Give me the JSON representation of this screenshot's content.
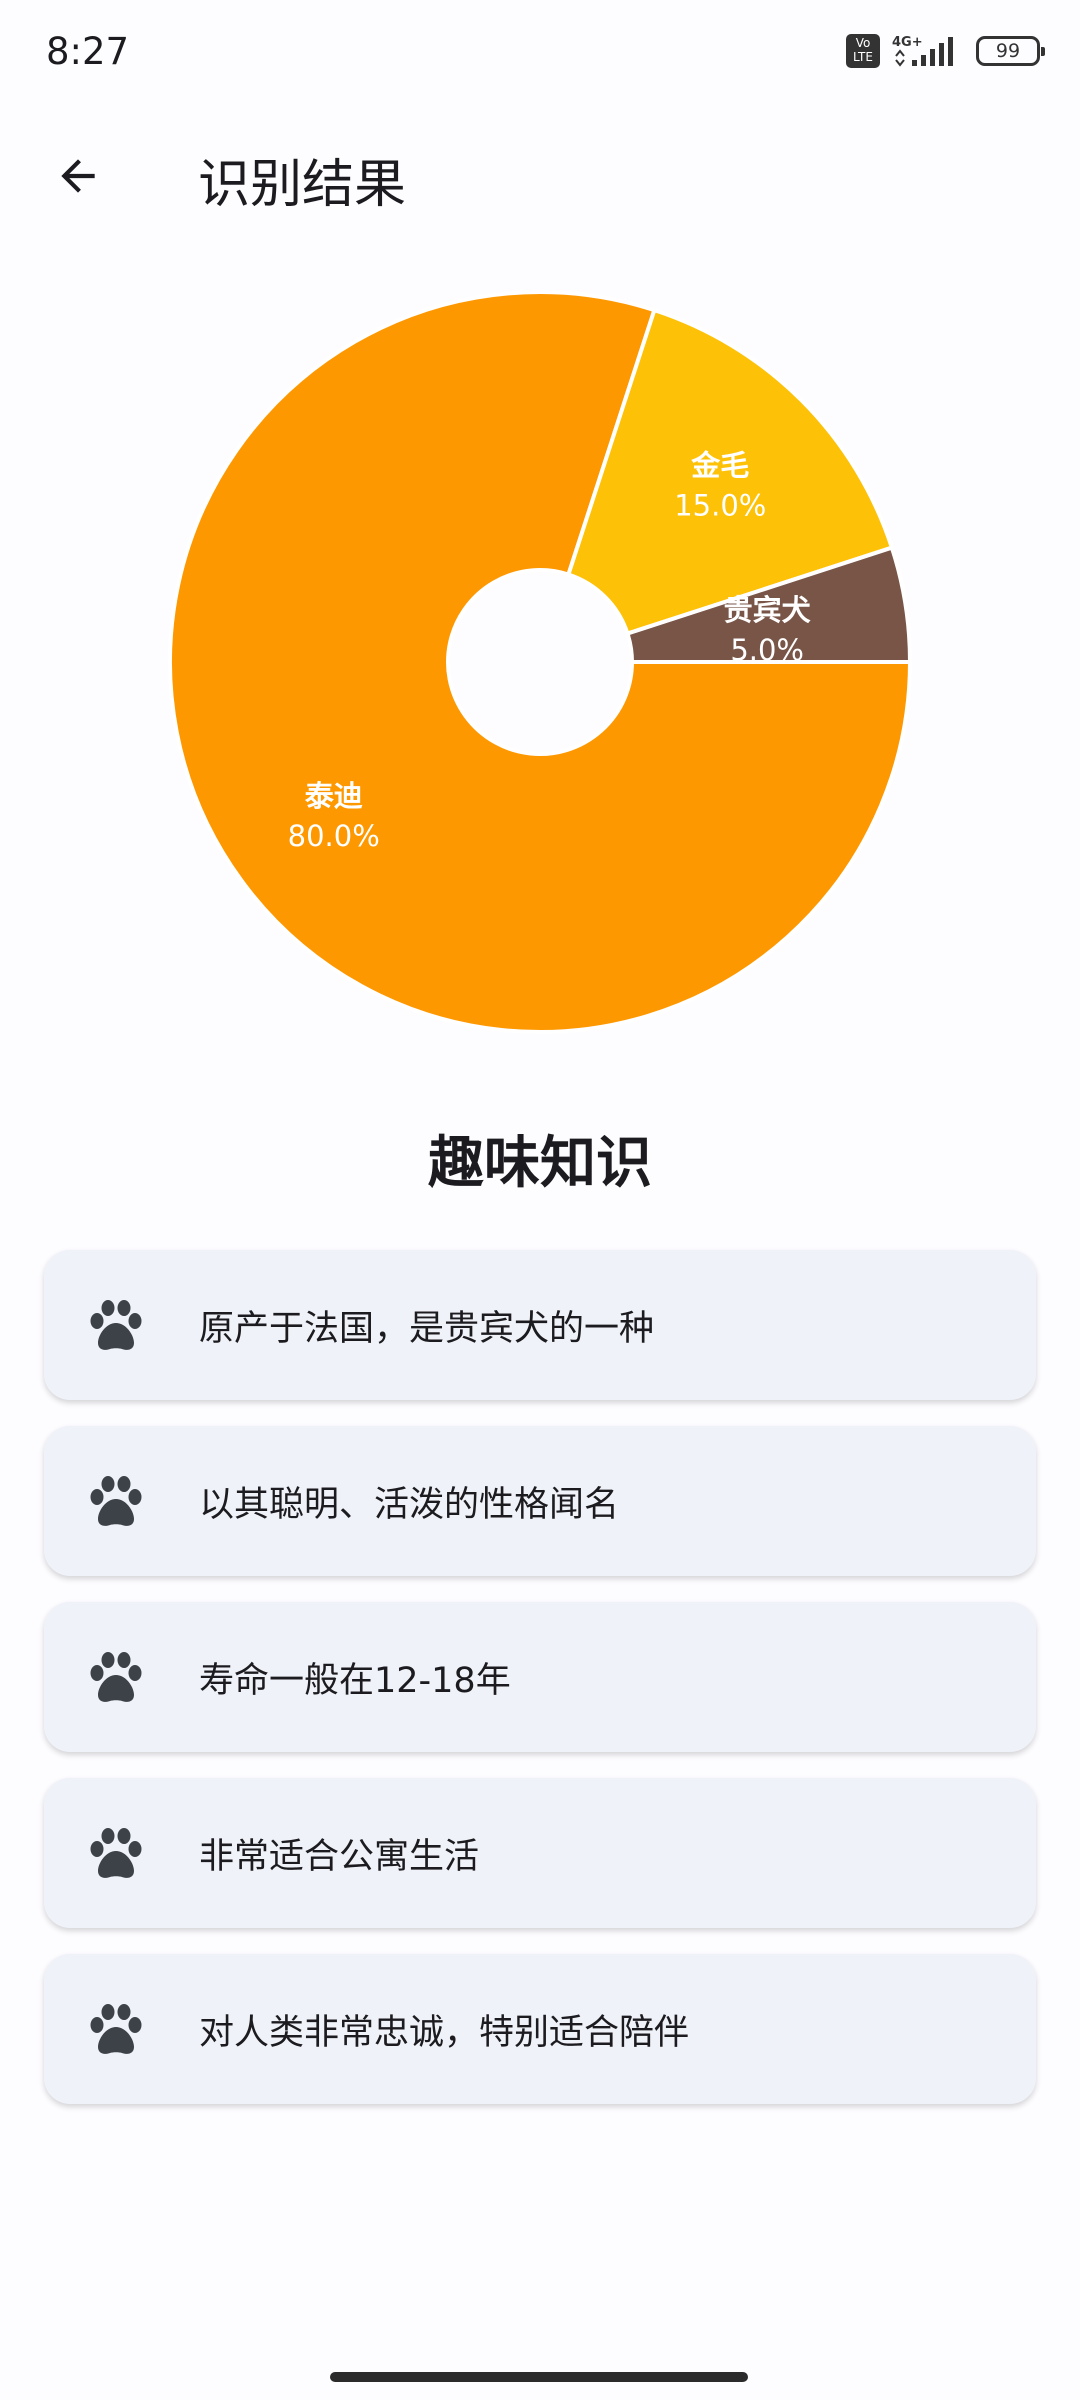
{
  "status_bar": {
    "time": "8:27",
    "volte": "Vo\nLTE",
    "network": "4G+",
    "battery": "99",
    "icons": [
      "volte-icon",
      "signal-icon",
      "battery-icon"
    ]
  },
  "app_bar": {
    "back_icon": "arrow-left-icon",
    "title": "识别结果"
  },
  "chart_data": {
    "type": "pie",
    "donut": true,
    "slices": [
      {
        "label": "泰迪",
        "percent_label": "80.0%",
        "value": 80.0,
        "color": "#fe9800"
      },
      {
        "label": "金毛",
        "percent_label": "15.0%",
        "value": 15.0,
        "color": "#fdc108"
      },
      {
        "label": "贵宾犬",
        "percent_label": "5.0%",
        "value": 5.0,
        "color": "#795548"
      }
    ]
  },
  "fun_facts": {
    "title": "趣味知识",
    "icon": "paw-icon",
    "items": [
      {
        "text": "原产于法国，是贵宾犬的一种"
      },
      {
        "text": "以其聪明、活泼的性格闻名"
      },
      {
        "text": "寿命一般在12-18年"
      },
      {
        "text": "非常适合公寓生活"
      },
      {
        "text": "对人类非常忠诚，特别适合陪伴"
      }
    ]
  },
  "colors": {
    "background": "#fdfcff",
    "card": "#eff2f9",
    "icon": "#3d4148"
  }
}
